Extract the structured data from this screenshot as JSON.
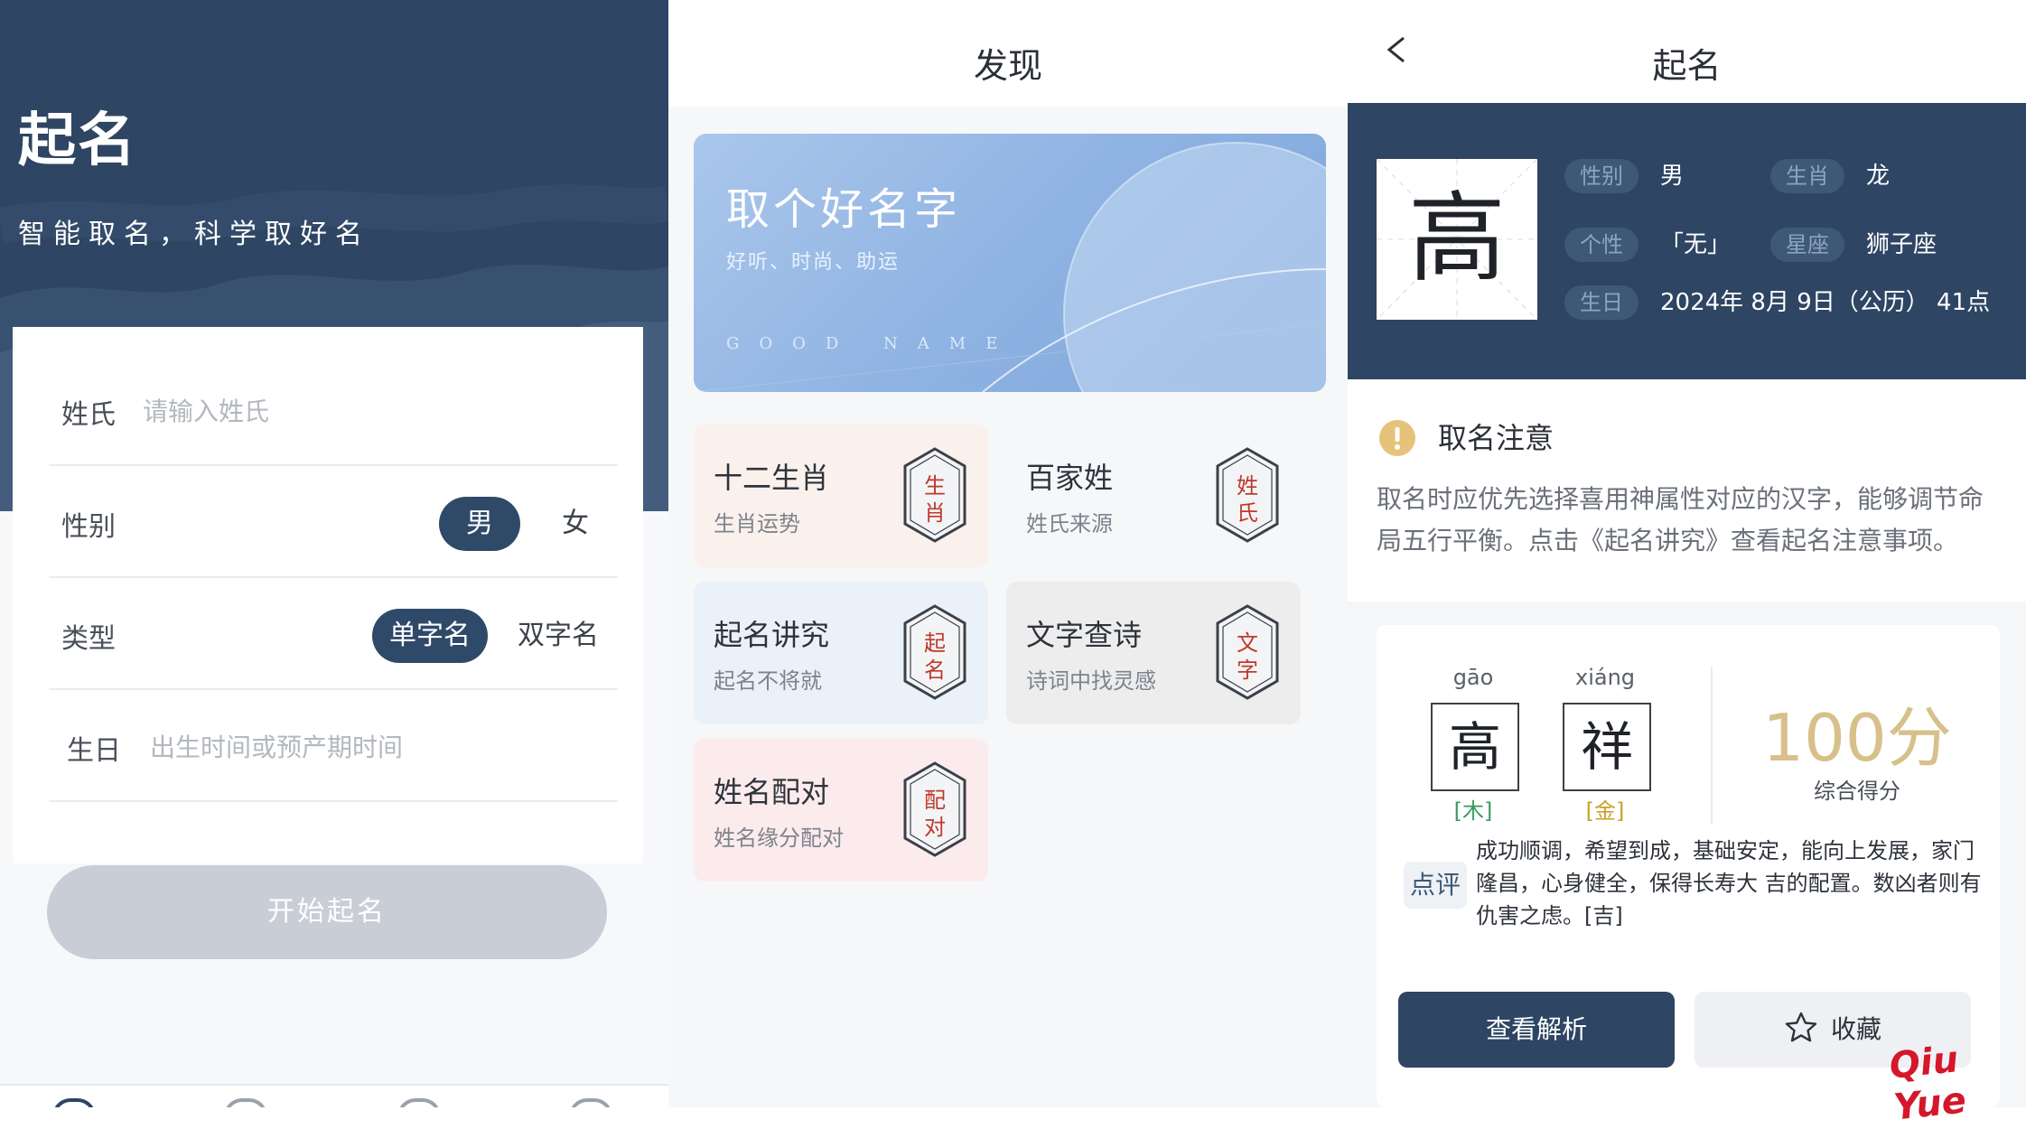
{
  "naming_form": {
    "title": "起名",
    "subtitle": "智能取名，科学取好名",
    "surname_label": "姓氏",
    "surname_placeholder": "请输入姓氏",
    "gender_label": "性别",
    "gender_male": "男",
    "gender_female": "女",
    "type_label": "类型",
    "type_single": "单字名",
    "type_double": "双字名",
    "birth_label": "生日",
    "birth_placeholder": "出生时间或预产期时间",
    "start_button": "开始起名"
  },
  "discover": {
    "title": "发现",
    "banner": {
      "title": "取个好名字",
      "subtitle": "好听、时尚、助运",
      "english": "GOOD NAME"
    },
    "tiles": [
      {
        "title": "十二生肖",
        "subtitle": "生肖运势",
        "seal": "生肖",
        "bg": "#fbf1ec"
      },
      {
        "title": "百家姓",
        "subtitle": "姓氏来源",
        "seal": "姓氏",
        "bg": "#f6f7f9"
      },
      {
        "title": "起名讲究",
        "subtitle": "起名不将就",
        "seal": "起名",
        "bg": "#eaf1f8"
      },
      {
        "title": "文字查诗",
        "subtitle": "诗词中找灵感",
        "seal": "文字",
        "bg": "#ededee"
      },
      {
        "title": "姓名配对",
        "subtitle": "姓名缘分配对",
        "seal": "配对",
        "bg": "#fcebed"
      }
    ]
  },
  "result": {
    "title": "起名",
    "big_char": "高",
    "info": {
      "gender_tag": "性别",
      "gender": "男",
      "zodiac_tag": "生肖",
      "zodiac": "龙",
      "personality_tag": "个性",
      "personality": "「无」",
      "star_tag": "星座",
      "star": "狮子座",
      "birth_tag": "生日",
      "birth": "2024年 8月 9日（公历） 41点"
    },
    "notice": {
      "title": "取名注意",
      "body": "取名时应优先选择喜用神属性对应的汉字，能够调节命局五行平衡。点击《起名讲究》查看起名注意事项。"
    },
    "name_chars": [
      {
        "pinyin": "gāo",
        "char": "高",
        "element": "[木]",
        "color": "#3c9a5f"
      },
      {
        "pinyin": "xiáng",
        "char": "祥",
        "element": "[金]",
        "color": "#c9a227"
      }
    ],
    "score": "100分",
    "score_label": "综合得分",
    "comment_tag": "点评",
    "comment": "成功顺调，希望到成，基础安定，能向上发展，家门隆昌，心身健全，保得长寿大 吉的配置。数凶者则有仇害之虑。[吉]",
    "analyze_button": "查看解析",
    "favorite_button": "收藏"
  },
  "watermark": "Qiu Yue",
  "colors": {
    "navy": "#2e4563",
    "gold": "#d7c08a"
  }
}
